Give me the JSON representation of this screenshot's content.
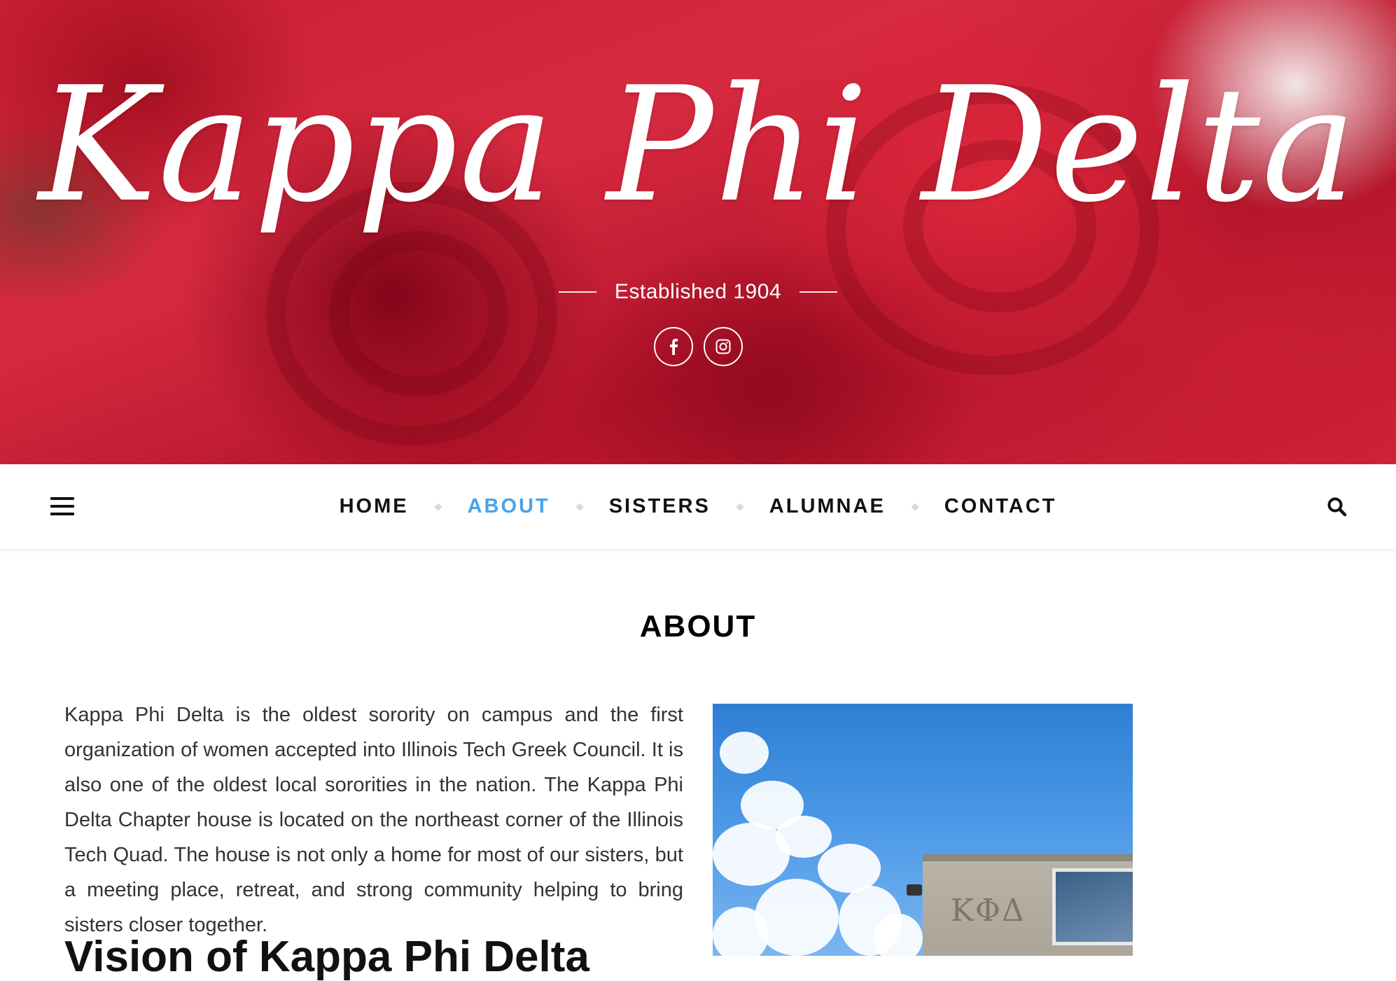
{
  "site": {
    "title": "Kappa Phi Delta",
    "tagline": "Established 1904"
  },
  "social": [
    {
      "name": "facebook",
      "icon": "facebook-icon",
      "glyph": "f"
    },
    {
      "name": "instagram",
      "icon": "instagram-icon"
    }
  ],
  "nav": {
    "items": [
      {
        "label": "HOME",
        "active": false
      },
      {
        "label": "ABOUT",
        "active": true
      },
      {
        "label": "SISTERS",
        "active": false
      },
      {
        "label": "ALUMNAE",
        "active": false
      },
      {
        "label": "CONTACT",
        "active": false
      }
    ],
    "active_color": "#4aa3e8"
  },
  "page": {
    "title": "ABOUT",
    "paragraph": "Kappa Phi Delta is the oldest sorority on campus and the first organization of women accepted into Illinois Tech Greek Council. It is also one of the oldest local sororities in the nation. The Kappa Phi Delta Chapter house is located on the northeast corner of the Illinois Tech Quad. The house is not only a home for most of our sisters, but a meeting place, retreat, and strong community helping to bring sisters closer together.",
    "vision_heading": "Vision of Kappa Phi Delta",
    "photo_letters": "ΚΦΔ"
  },
  "colors": {
    "banner_red": "#c81e32",
    "accent_blue": "#4aa3e8"
  }
}
